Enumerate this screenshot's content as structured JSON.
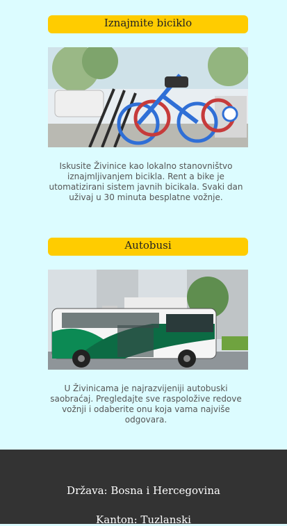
{
  "sections": [
    {
      "title": "Iznajmite biciklo",
      "image_alt": "bike-sharing station",
      "description": "Iskusite Živinice kao lokalno stanovništvo iznajmljivanjem bicikla. Rent a bike je utomatizirani sistem javnih bicikala. Svaki dan uživaj u 30 minuta besplatne vožnje."
    },
    {
      "title": "Autobusi",
      "image_alt": "city bus",
      "description": "U Živinicama je najrazvijeniji autobuski saobraćaj. Pregledajte sve raspoložive redove vožnji i odaberite onu koja vama najviše odgovara."
    }
  ],
  "footer": {
    "country": "Država: Bosna i Hercegovina",
    "canton": "Kanton: Tuzlanski"
  },
  "colors": {
    "background": "#dcfcff",
    "accent": "#ffcc00",
    "footer": "#333333"
  }
}
